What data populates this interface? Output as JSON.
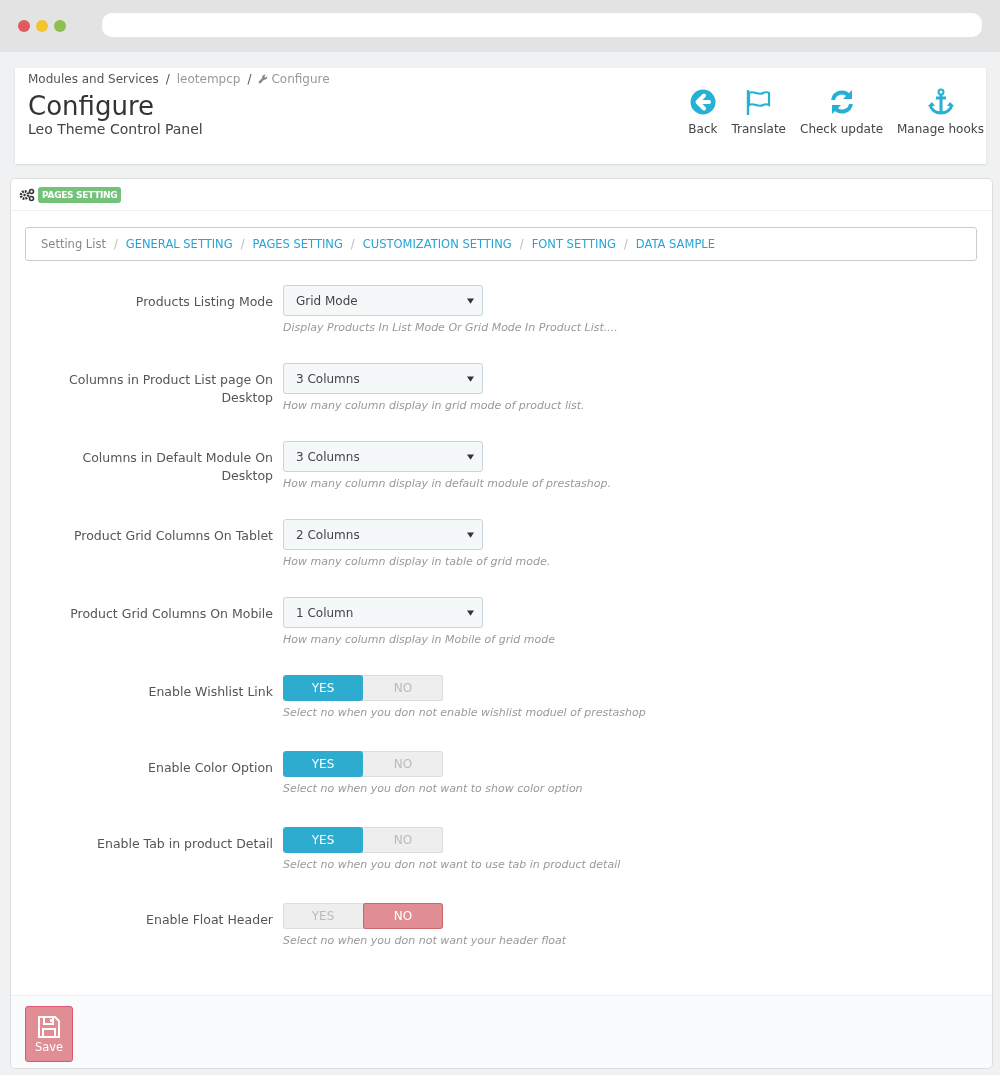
{
  "breadcrumb": [
    {
      "label": "Modules and Services"
    },
    {
      "separator": "/",
      "label": "leotempcp"
    },
    {
      "separator": "/",
      "label": "Configure"
    }
  ],
  "page_title": "Configure",
  "page_subtitle": "Leo Theme Control Panel",
  "toolbar": [
    {
      "label": "Back",
      "kind": "back"
    },
    {
      "label": "Translate",
      "kind": "flag"
    },
    {
      "label": "Check update",
      "kind": "refresh"
    },
    {
      "label": "Manage hooks",
      "kind": "anchor"
    }
  ],
  "panel": {
    "badge": "PAGES SETTING"
  },
  "setting_nav": [
    {
      "label": "Setting List",
      "link": false
    },
    {
      "separator": "/",
      "label": "GENERAL SETTING",
      "link": true
    },
    {
      "separator": "/",
      "label": "PAGES SETTING",
      "link": true
    },
    {
      "separator": "/",
      "label": "CUSTOMIZATION SETTING",
      "link": true
    },
    {
      "separator": "/",
      "label": "FONT SETTING",
      "link": true
    },
    {
      "separator": "/",
      "label": "DATA SAMPLE",
      "link": true
    }
  ],
  "fields": [
    {
      "kind": "select",
      "label": "Products Listing Mode",
      "value": "Grid Mode",
      "help": "Display Products In List Mode Or Grid Mode In Product List...."
    },
    {
      "kind": "select",
      "label": "Columns in Product List page On Desktop",
      "value": "3 Columns",
      "help": "How many column display in grid mode of product list."
    },
    {
      "kind": "select",
      "label": "Columns in Default Module On Desktop",
      "value": "3 Columns",
      "help": "How many column display in default module of prestashop."
    },
    {
      "kind": "select",
      "label": "Product Grid Columns On Tablet",
      "value": "2 Columns",
      "help": "How many column display in table of grid mode."
    },
    {
      "kind": "select",
      "label": "Product Grid Columns On Mobile",
      "value": "1 Column",
      "help": "How many column display in Mobile of grid mode"
    },
    {
      "kind": "toggle",
      "label": "Enable Wishlist Link",
      "yes": "YES",
      "no": "NO",
      "on": true,
      "help": "Select no when you don not enable wishlist moduel of prestashop"
    },
    {
      "kind": "toggle",
      "label": "Enable Color Option",
      "yes": "YES",
      "no": "NO",
      "on": true,
      "help": "Select no when you don not want to show color option"
    },
    {
      "kind": "toggle",
      "label": "Enable Tab in product Detail",
      "yes": "YES",
      "no": "NO",
      "on": true,
      "help": "Select no when you don not want to use tab in product detail"
    },
    {
      "kind": "toggle",
      "label": "Enable Float Header",
      "yes": "YES",
      "no": "NO",
      "on": false,
      "help": "Select no when you don not want your header float"
    }
  ],
  "save_button": "Save"
}
